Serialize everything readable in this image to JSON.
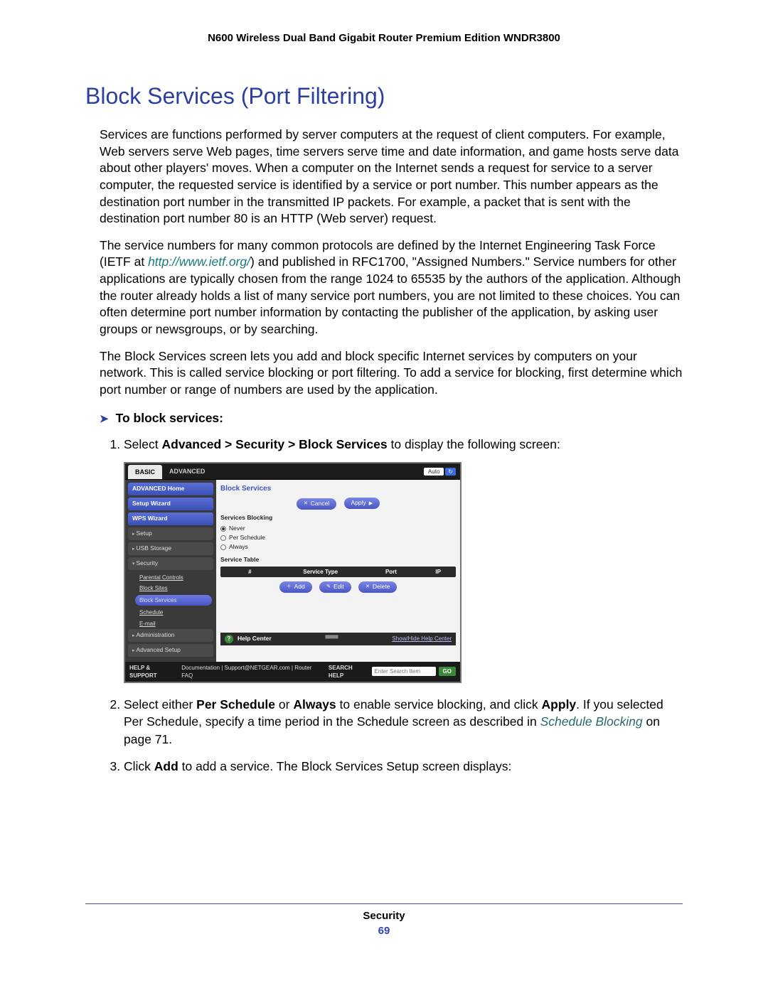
{
  "header": "N600 Wireless Dual Band Gigabit Router Premium Edition WNDR3800",
  "title": "Block Services (Port Filtering)",
  "para1": "Services are functions performed by server computers at the request of client computers. For example, Web servers serve Web pages, time servers serve time and date information, and game hosts serve data about other players' moves. When a computer on the Internet sends a request for service to a server computer, the requested service is identified by a service or port number. This number appears as the destination port number in the transmitted IP packets. For example, a packet that is sent with the destination port number 80 is an HTTP (Web server) request.",
  "para2_lead": "The service numbers for many common protocols are defined by the Internet Engineering Task Force (IETF at ",
  "ietf_url": "http://www.ietf.org/",
  "para2_tail": ") and published in RFC1700, \"Assigned Numbers.\" Service numbers for other applications are typically chosen from the range 1024 to 65535 by the authors of the application. Although the router already holds a list of many service port numbers, you are not limited to these choices. You can often determine port number information by contacting the publisher of the application, by asking user groups or newsgroups, or by searching.",
  "para3": "The Block Services screen lets you add and block specific Internet services by computers on your network. This is called service blocking or port filtering. To add a service for blocking, first determine which port number or range of numbers are used by the application.",
  "task_heading": "To block services:",
  "step1_a": "Select ",
  "step1_bold": "Advanced > Security > Block Services",
  "step1_b": " to display the following screen:",
  "step2_a": "Select either ",
  "step2_b1": "Per Schedule",
  "step2_mid": " or ",
  "step2_b2": "Always",
  "step2_c": " to enable service blocking, and click ",
  "step2_apply": "Apply",
  "step2_d": ". If you selected Per Schedule, specify a time period in the Schedule screen as described in ",
  "step2_xref": "Schedule Blocking",
  "step2_e": " on page 71.",
  "step3_a": "Click ",
  "step3_add": "Add",
  "step3_b": " to add a service. The Block Services Setup screen displays:",
  "footer_section": "Security",
  "footer_page": "69",
  "shot": {
    "tabs": {
      "basic": "BASIC",
      "advanced": "ADVANCED"
    },
    "top_auto": "Auto",
    "side": {
      "home": "ADVANCED Home",
      "wizard": "Setup Wizard",
      "wps": "WPS Wizard",
      "setup": "Setup",
      "usb": "USB Storage",
      "security": "Security",
      "sub": {
        "parental": "Parental Controls",
        "blocksites": "Block Sites",
        "blockservices": "Block Services",
        "schedule": "Schedule",
        "email": "E-mail"
      },
      "admin": "Administration",
      "advsetup": "Advanced Setup"
    },
    "main": {
      "panel_title": "Block Services",
      "cancel": "Cancel",
      "apply": "Apply",
      "sb_title": "Services Blocking",
      "r_never": "Never",
      "r_sched": "Per Schedule",
      "r_always": "Always",
      "svc_table": "Service Table",
      "th_n": "#",
      "th_type": "Service Type",
      "th_port": "Port",
      "th_ip": "IP",
      "add": "Add",
      "edit": "Edit",
      "delete": "Delete"
    },
    "helpcenter": {
      "label": "Help Center",
      "showhide": "Show/Hide Help Center"
    },
    "bottom": {
      "hs": "HELP & SUPPORT",
      "links": "Documentation | Support@NETGEAR.com | Router FAQ",
      "search_label": "SEARCH HELP",
      "search_ph": "Enter Search Item",
      "go": "GO"
    }
  }
}
